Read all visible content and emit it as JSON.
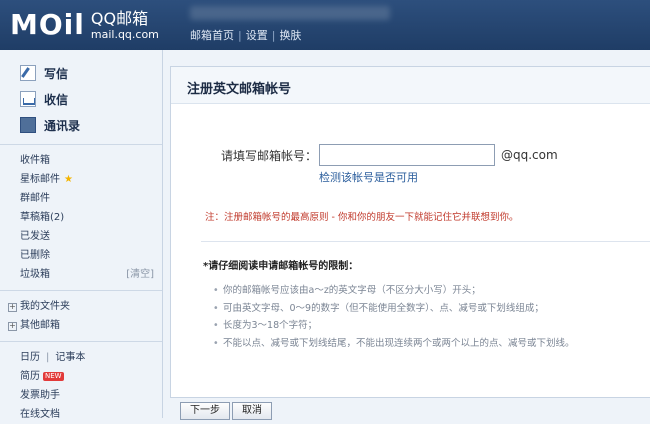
{
  "header": {
    "logo_main": "MOil",
    "logo_sub1": "QQ邮箱",
    "logo_sub2": "mail.qq.com",
    "links": [
      "邮箱首页",
      "设置",
      "换肤"
    ],
    "link_sep": "|"
  },
  "sidebar": {
    "main_items": [
      {
        "label": "写信",
        "icon": "compose-icon"
      },
      {
        "label": "收信",
        "icon": "inbox-icon"
      },
      {
        "label": "通讯录",
        "icon": "addressbook-icon"
      }
    ],
    "folders": [
      "收件箱",
      "星标邮件",
      "群邮件",
      "草稿箱(2)",
      "已发送",
      "已删除",
      "垃圾箱"
    ],
    "star_glyph": "★",
    "trash_clear": "[清空]",
    "groups": [
      "我的文件夹",
      "其他邮箱"
    ],
    "expand_glyph": "+",
    "tools": {
      "calendar": "日历",
      "sep": "|",
      "notebook": "记事本",
      "resume": "简历",
      "new_badge": "NEW",
      "invoice": "发票助手",
      "docs": "在线文档"
    }
  },
  "main": {
    "title": "注册英文邮箱帐号",
    "field_label": "请填写邮箱帐号：",
    "field_value": "",
    "domain": "@qq.com",
    "check_link": "检测该帐号是否可用",
    "note": "注：注册邮箱帐号的最高原则 - 你和你的朋友一下就能记住它并联想到你。",
    "rules_title": "*请仔细阅读申请邮箱帐号的限制：",
    "rules": [
      "你的邮箱帐号应该由a～z的英文字母（不区分大小写）开头；",
      "可由英文字母、0～9的数字（但不能使用全数字）、点、减号或下划线组成；",
      "长度为3～18个字符；",
      "不能以点、减号或下划线结尾，不能出现连续两个或两个以上的点、减号或下划线。"
    ]
  },
  "buttons": {
    "next": "下一步",
    "cancel": "取消"
  },
  "colors": {
    "topbar": "#1f3d66",
    "link": "#2a5d9c",
    "note": "#c0392b"
  }
}
